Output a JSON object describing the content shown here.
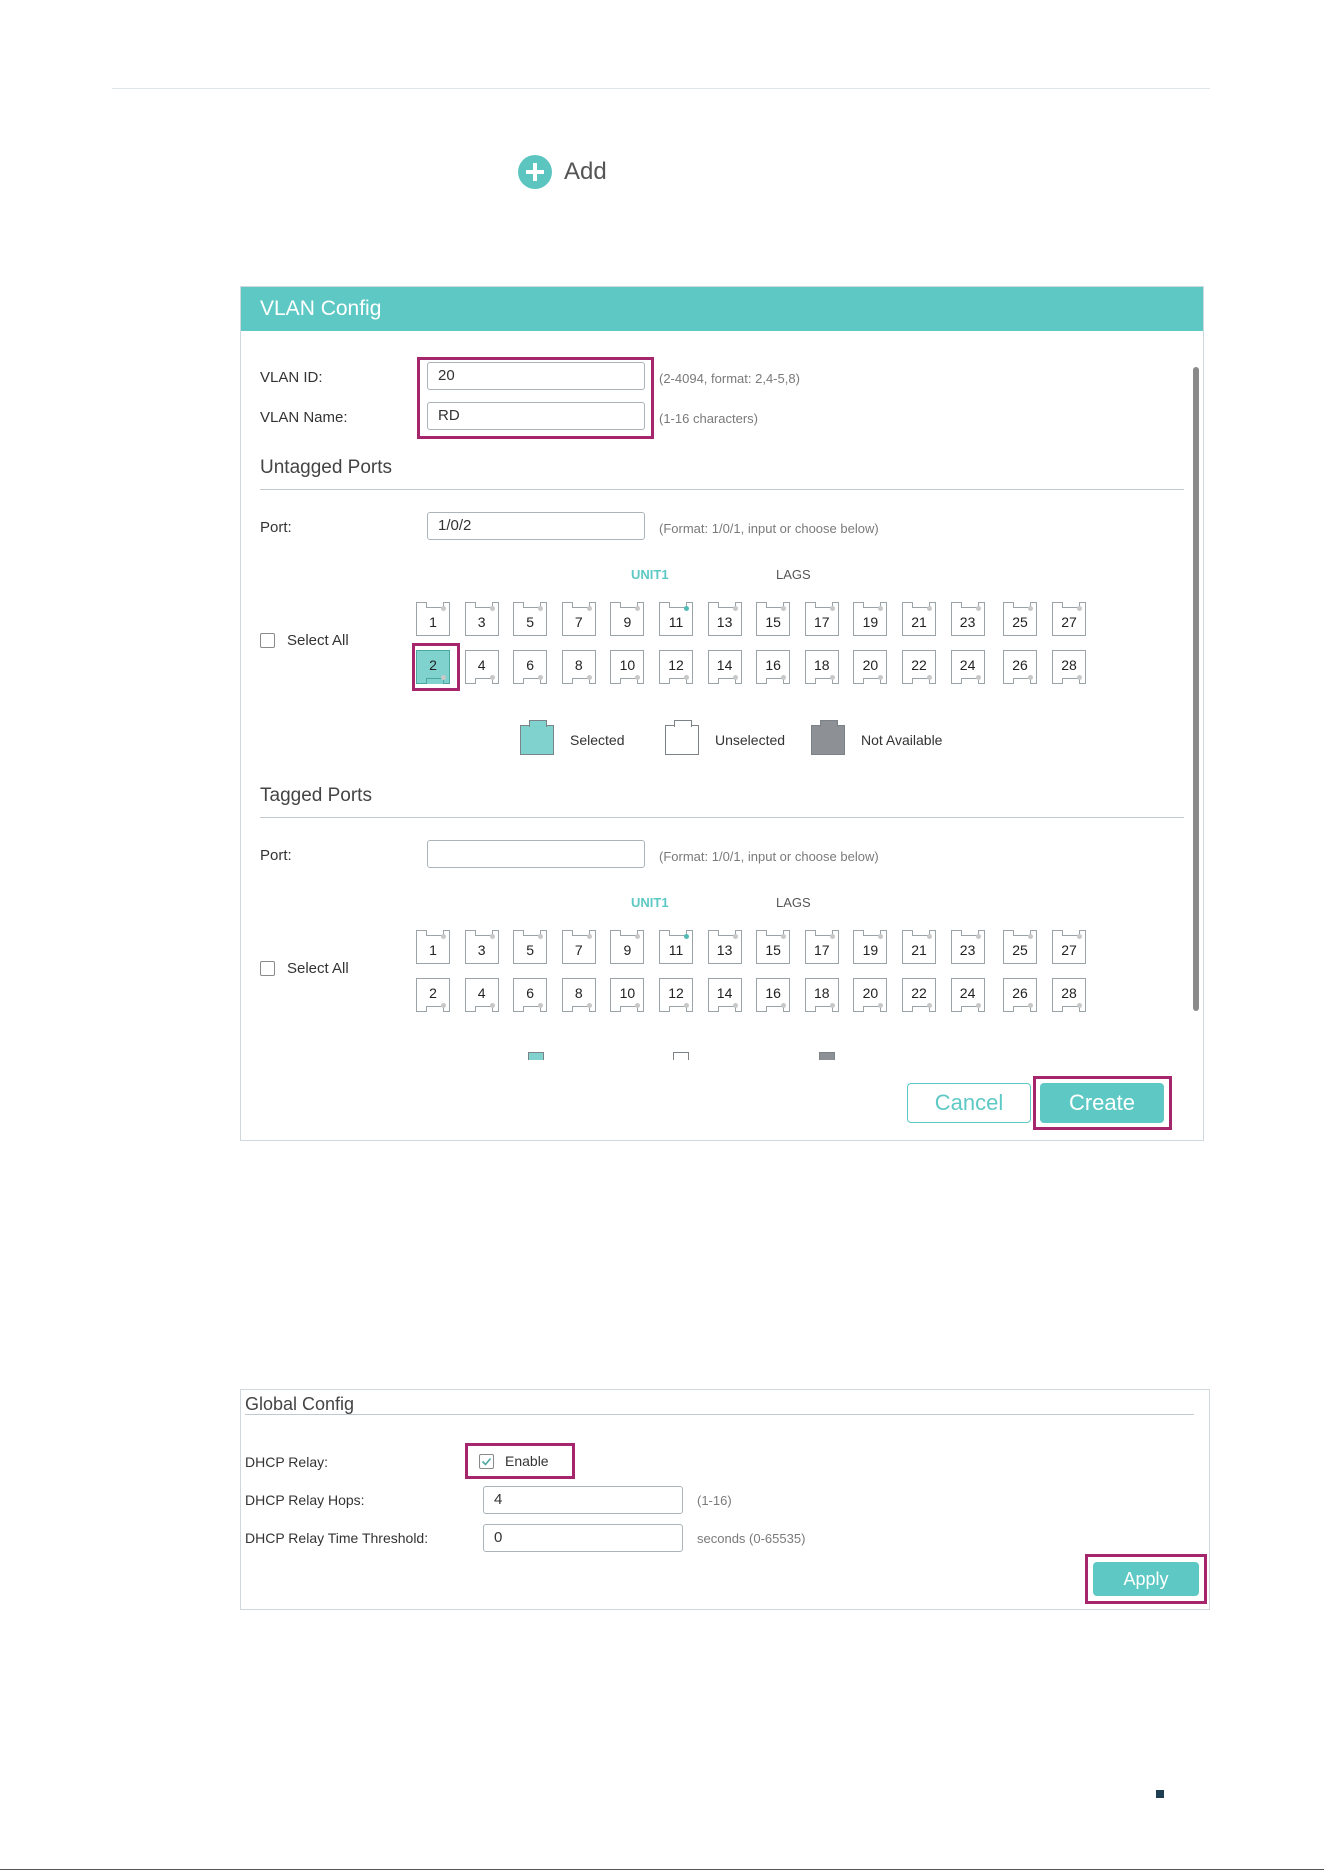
{
  "toolbar": {
    "add_label": "Add"
  },
  "vlan_config": {
    "title": "VLAN Config",
    "vlan_id_label": "VLAN ID:",
    "vlan_id_value": "20",
    "vlan_id_hint": "(2-4094, format: 2,4-5,8)",
    "vlan_name_label": "VLAN Name:",
    "vlan_name_value": "RD",
    "vlan_name_hint": "(1-16 characters)",
    "untagged": {
      "title": "Untagged Ports",
      "port_label": "Port:",
      "port_value": "1/0/2",
      "port_hint": "(Format: 1/0/1, input or choose below)",
      "unit_label": "UNIT1",
      "lags_label": "LAGS",
      "select_all": "Select All",
      "selected_port": "2"
    },
    "legend": {
      "selected": "Selected",
      "unselected": "Unselected",
      "not_available": "Not Available"
    },
    "tagged": {
      "title": "Tagged Ports",
      "port_label": "Port:",
      "port_value": "",
      "port_hint": "(Format: 1/0/1, input or choose below)",
      "unit_label": "UNIT1",
      "lags_label": "LAGS",
      "select_all": "Select All"
    },
    "ports_top": [
      "1",
      "3",
      "5",
      "7",
      "9",
      "11",
      "13",
      "15",
      "17",
      "19",
      "21",
      "23"
    ],
    "ports_bottom": [
      "2",
      "4",
      "6",
      "8",
      "10",
      "12",
      "14",
      "16",
      "18",
      "20",
      "22",
      "24"
    ],
    "lags_top": [
      "25",
      "27"
    ],
    "lags_bottom": [
      "26",
      "28"
    ],
    "active_port": "11",
    "cancel_label": "Cancel",
    "create_label": "Create"
  },
  "global_config": {
    "title": "Global Config",
    "dhcp_relay_label": "DHCP Relay:",
    "dhcp_relay_enable": "Enable",
    "dhcp_relay_enabled": true,
    "hops_label": "DHCP Relay Hops:",
    "hops_value": "4",
    "hops_hint": "(1-16)",
    "threshold_label": "DHCP Relay Time Threshold:",
    "threshold_value": "0",
    "threshold_hint": "seconds (0-65535)",
    "apply_label": "Apply"
  },
  "colors": {
    "accent": "#5ec9c4",
    "highlight": "#a6266e",
    "not_available": "#8d9094"
  }
}
